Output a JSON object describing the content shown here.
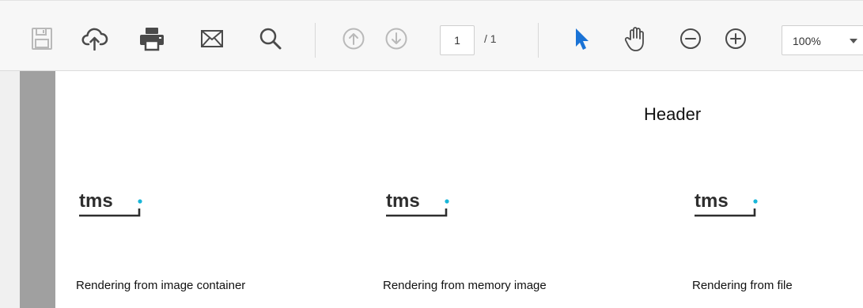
{
  "toolbar": {
    "buttons": [
      {
        "name": "save",
        "icon": "floppy-disk-icon",
        "enabled": false
      },
      {
        "name": "upload",
        "icon": "cloud-upload-icon",
        "enabled": true
      },
      {
        "name": "print",
        "icon": "printer-icon",
        "enabled": true
      },
      {
        "name": "email",
        "icon": "envelope-icon",
        "enabled": true
      },
      {
        "name": "search",
        "icon": "search-icon",
        "enabled": true
      },
      {
        "name": "previous-page",
        "icon": "arrow-up-circle-icon",
        "enabled": false
      },
      {
        "name": "next-page",
        "icon": "arrow-down-circle-icon",
        "enabled": false
      },
      {
        "name": "select-tool",
        "icon": "pointer-arrow-icon",
        "enabled": true,
        "active": true
      },
      {
        "name": "hand-tool",
        "icon": "hand-icon",
        "enabled": true
      },
      {
        "name": "zoom-out",
        "icon": "minus-circle-icon",
        "enabled": true
      },
      {
        "name": "zoom-in",
        "icon": "plus-circle-icon",
        "enabled": true
      }
    ],
    "page_number": "1",
    "page_total": "/ 1",
    "zoom": "100%"
  },
  "document": {
    "header": "Header",
    "logo_text": "tms",
    "captions": [
      "Rendering from image container",
      "Rendering from memory image",
      "Rendering from file"
    ]
  },
  "colors": {
    "accent": "#1a73d6",
    "icon": "#4a4a4a",
    "icon_disabled": "#b9b9b9",
    "logo_dot": "#19b6d8"
  }
}
